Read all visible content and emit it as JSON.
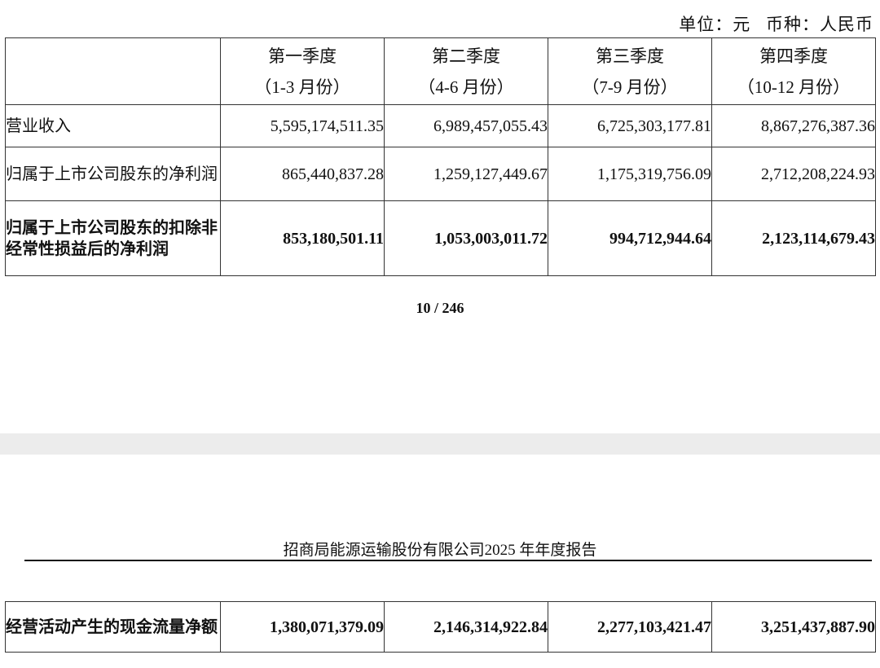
{
  "unit_line": "单位：元   币种：人民币",
  "quarters": [
    {
      "name": "第一季度",
      "months": "（1-3 月份）"
    },
    {
      "name": "第二季度",
      "months": "（4-6 月份）"
    },
    {
      "name": "第三季度",
      "months": "（7-9 月份）"
    },
    {
      "name": "第四季度",
      "months": "（10-12 月份）"
    }
  ],
  "rows": [
    {
      "label": "营业收入",
      "values": [
        "5,595,174,511.35",
        "6,989,457,055.43",
        "6,725,303,177.81",
        "8,867,276,387.36"
      ]
    },
    {
      "label": "归属于上市公司股东的净利润",
      "values": [
        "865,440,837.28",
        "1,259,127,449.67",
        "1,175,319,756.09",
        "2,712,208,224.93"
      ]
    },
    {
      "label": "归属于上市公司股东的扣除非经常性损益后的净利润",
      "values": [
        "853,180,501.11",
        "1,053,003,011.72",
        "994,712,944.64",
        "2,123,114,679.43"
      ]
    }
  ],
  "page_number": "10 / 246",
  "report_header": "招商局能源运输股份有限公司2025 年年度报告",
  "cashflow_row": {
    "label": "经营活动产生的现金流量净额",
    "values": [
      "1,380,071,379.09",
      "2,146,314,922.84",
      "2,277,103,421.47",
      "3,251,437,887.90"
    ]
  }
}
